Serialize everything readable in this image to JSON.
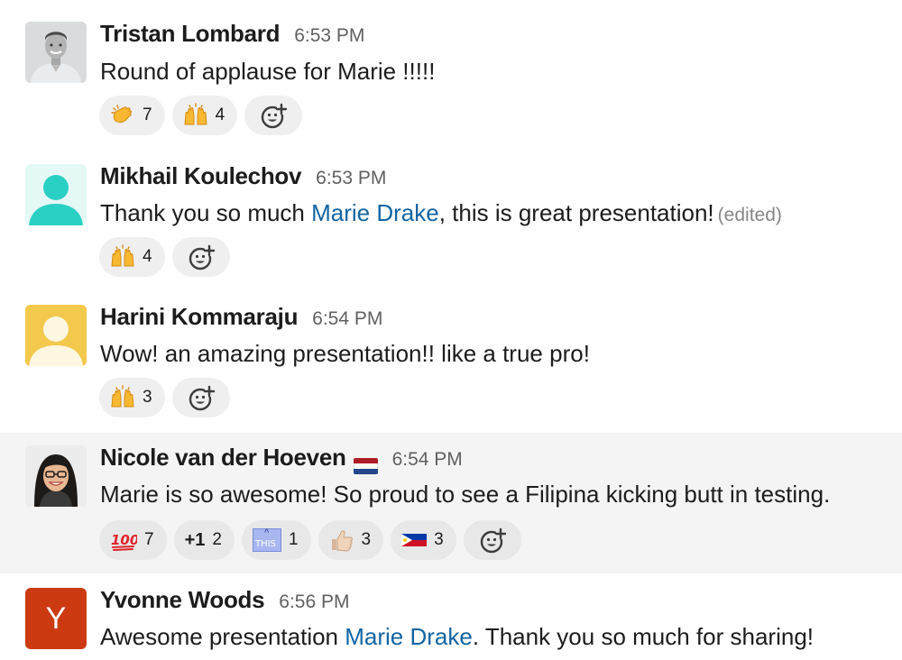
{
  "messages": [
    {
      "author": "Tristan Lombard",
      "time": "6:53 PM",
      "text": "Round of applause for Marie !!!!!",
      "avatar": "photo-man",
      "reactions": [
        {
          "emoji": "clapping-hands",
          "count": "7"
        },
        {
          "emoji": "raising-hands",
          "count": "4"
        }
      ]
    },
    {
      "author": "Mikhail Koulechov",
      "time": "6:53 PM",
      "text_before": "Thank you so much ",
      "mention": "Marie Drake",
      "text_after": ", this is great presentation!",
      "edited": "(edited)",
      "avatar": "default-teal",
      "reactions": [
        {
          "emoji": "raising-hands",
          "count": "4"
        }
      ]
    },
    {
      "author": "Harini Kommaraju",
      "time": "6:54 PM",
      "text": "Wow! an amazing presentation!! like a true pro!",
      "avatar": "default-yellow",
      "reactions": [
        {
          "emoji": "raising-hands",
          "count": "3"
        }
      ]
    },
    {
      "author": "Nicole van der Hoeven",
      "time": "6:54 PM",
      "status_emoji": "flag-netherlands",
      "text": "Marie is so awesome! So proud to see a Filipina kicking butt in testing.",
      "avatar": "photo-woman",
      "reactions": [
        {
          "emoji": "hundred-points",
          "label": "💯",
          "count": "7"
        },
        {
          "emoji": "plus-one",
          "label": "+1",
          "count": "2"
        },
        {
          "emoji": "this-up",
          "label": "THIS",
          "count": "1"
        },
        {
          "emoji": "thumbs-up",
          "count": "3"
        },
        {
          "emoji": "flag-philippines",
          "count": "3"
        }
      ]
    },
    {
      "author": "Yvonne Woods",
      "time": "6:56 PM",
      "text_before": "Awesome presentation ",
      "mention": "Marie Drake",
      "text_after": ". Thank you so much for sharing!",
      "avatar_letter": "Y",
      "reactions": []
    }
  ],
  "add_reaction_icon": "add-reaction-icon",
  "colors": {
    "mention": "#1264a3",
    "highlight_row": "#f4f4f4",
    "reaction_pill": "#efefef",
    "teal_avatar": "#2bd0c4",
    "yellow_avatar": "#f2c94c",
    "y_avatar": "#cc3a12"
  }
}
